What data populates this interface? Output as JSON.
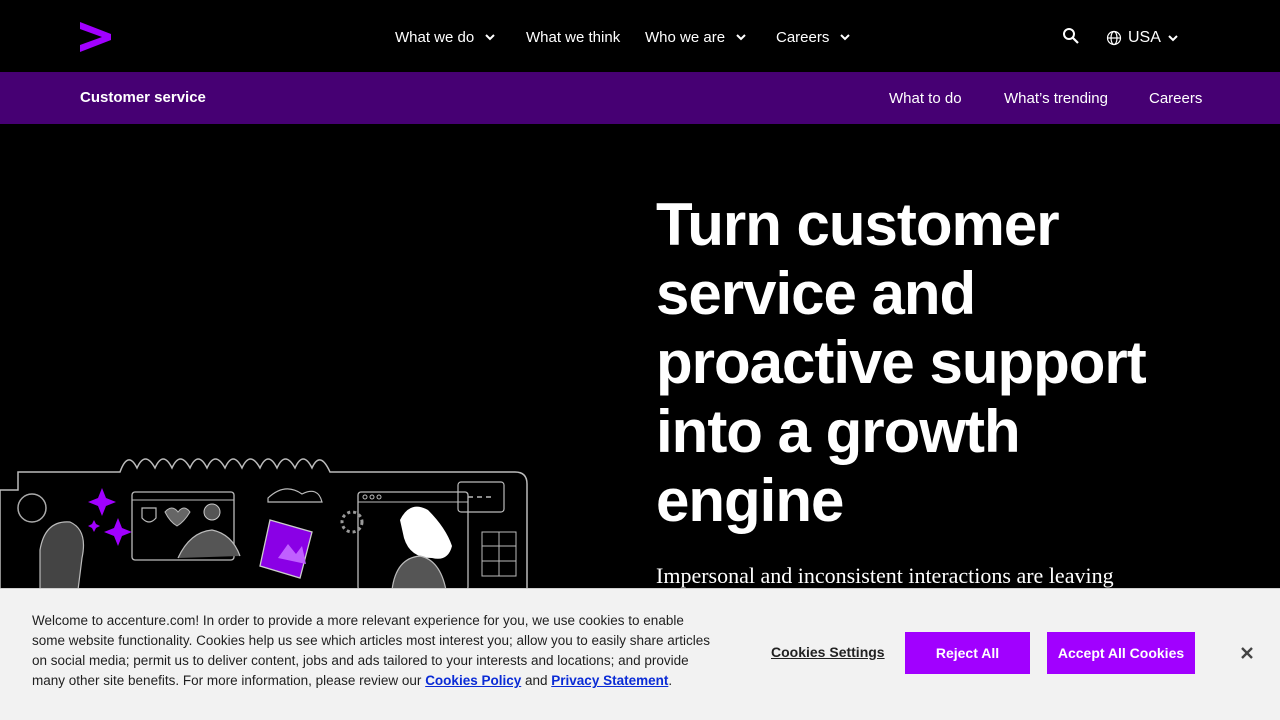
{
  "nav": {
    "items": [
      {
        "label": "What we do"
      },
      {
        "label": "What we think"
      },
      {
        "label": "Who we are"
      },
      {
        "label": "Careers"
      }
    ],
    "country": "USA"
  },
  "subnav": {
    "title": "Customer service",
    "links": [
      {
        "label": "What to do"
      },
      {
        "label": "What’s trending"
      },
      {
        "label": "Careers"
      }
    ]
  },
  "hero": {
    "title": "Turn customer service and proactive support into a growth engine",
    "subtitle": "Impersonal and inconsistent interactions are leaving"
  },
  "cookie": {
    "text_before": "Welcome to accenture.com! In order to provide a more relevant experience for you, we use cookies to enable some website functionality. Cookies help us see which articles most interest you; allow you to easily share articles on social media; permit us to deliver content, jobs and ads tailored to your interests and locations; and provide many other site benefits. For more information, please review our ",
    "cookies_policy": "Cookies Policy",
    "and": " and",
    "privacy_statement": "Privacy Statement",
    "period": ".",
    "settings": "Cookies Settings",
    "reject": "Reject All",
    "accept": "Accept All Cookies"
  },
  "colors": {
    "brand_purple": "#a100ff",
    "subnav_bg": "#460073",
    "background": "#000000",
    "banner_bg": "#f2f2f2"
  }
}
